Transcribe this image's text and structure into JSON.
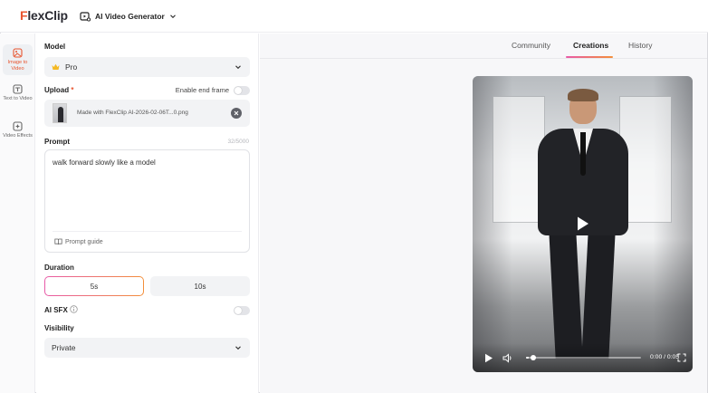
{
  "header": {
    "logo_first": "F",
    "logo_rest": "lexClip",
    "tool_label": "AI Video Generator"
  },
  "rail": {
    "items": [
      {
        "label": "Image to Video",
        "active": true
      },
      {
        "label": "Text to Video",
        "active": false
      },
      {
        "label": "Video Effects",
        "active": false
      }
    ]
  },
  "panel": {
    "model_label": "Model",
    "model_value": "Pro",
    "upload_label": "Upload",
    "upload_required": "*",
    "end_frame_label": "Enable end frame",
    "file_name": "Made with FlexClip AI-2026-02-06T...0.png",
    "prompt_label": "Prompt",
    "prompt_counter": "32/5000",
    "prompt_text": "walk forward slowly like a model",
    "prompt_guide": "Prompt guide",
    "duration_label": "Duration",
    "duration_options": [
      "5s",
      "10s"
    ],
    "duration_selected": "5s",
    "sfx_label": "AI SFX",
    "visibility_label": "Visibility",
    "visibility_value": "Private"
  },
  "main": {
    "tabs": [
      {
        "label": "Community",
        "active": false
      },
      {
        "label": "Creations",
        "active": true
      },
      {
        "label": "History",
        "active": false
      }
    ],
    "video": {
      "time": "0:00 / 0:05",
      "progress": 0.02
    }
  },
  "colors": {
    "brand": "#e8542f",
    "accent_gradient_start": "#e85aa8",
    "accent_gradient_end": "#f38f3a"
  }
}
